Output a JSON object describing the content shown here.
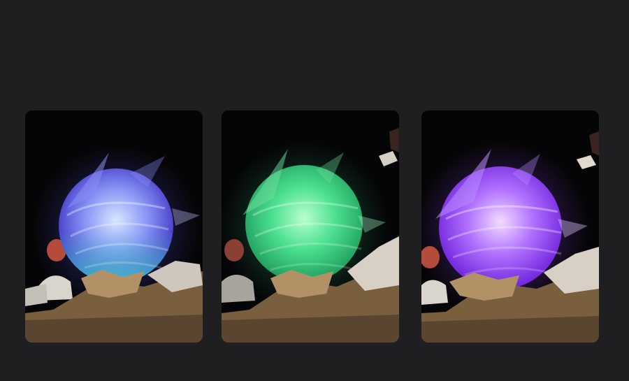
{
  "panels": [
    {
      "id": "blue",
      "orb_center": "#d6e6ff",
      "orb_mid": "#6f7cf0",
      "orb_edge": "#3a34c0",
      "rim": "#42d6c8",
      "glow": "#5c5cff"
    },
    {
      "id": "green",
      "orb_center": "#b8ffd0",
      "orb_mid": "#3cd383",
      "orb_edge": "#1d8c55",
      "rim": "#66ffb0",
      "glow": "#2fd47f"
    },
    {
      "id": "purple",
      "orb_center": "#f2dcff",
      "orb_mid": "#a75cff",
      "orb_edge": "#6920d6",
      "rim": "#c57bff",
      "glow": "#9b43ff"
    }
  ],
  "colors": {
    "background": "#1f1f22",
    "panel_bg": "#050507",
    "rock": "#7a5f3e",
    "rock_light": "#b39167",
    "figure_red": "#b54b3b",
    "figure_cloth": "#d9d5cc"
  }
}
